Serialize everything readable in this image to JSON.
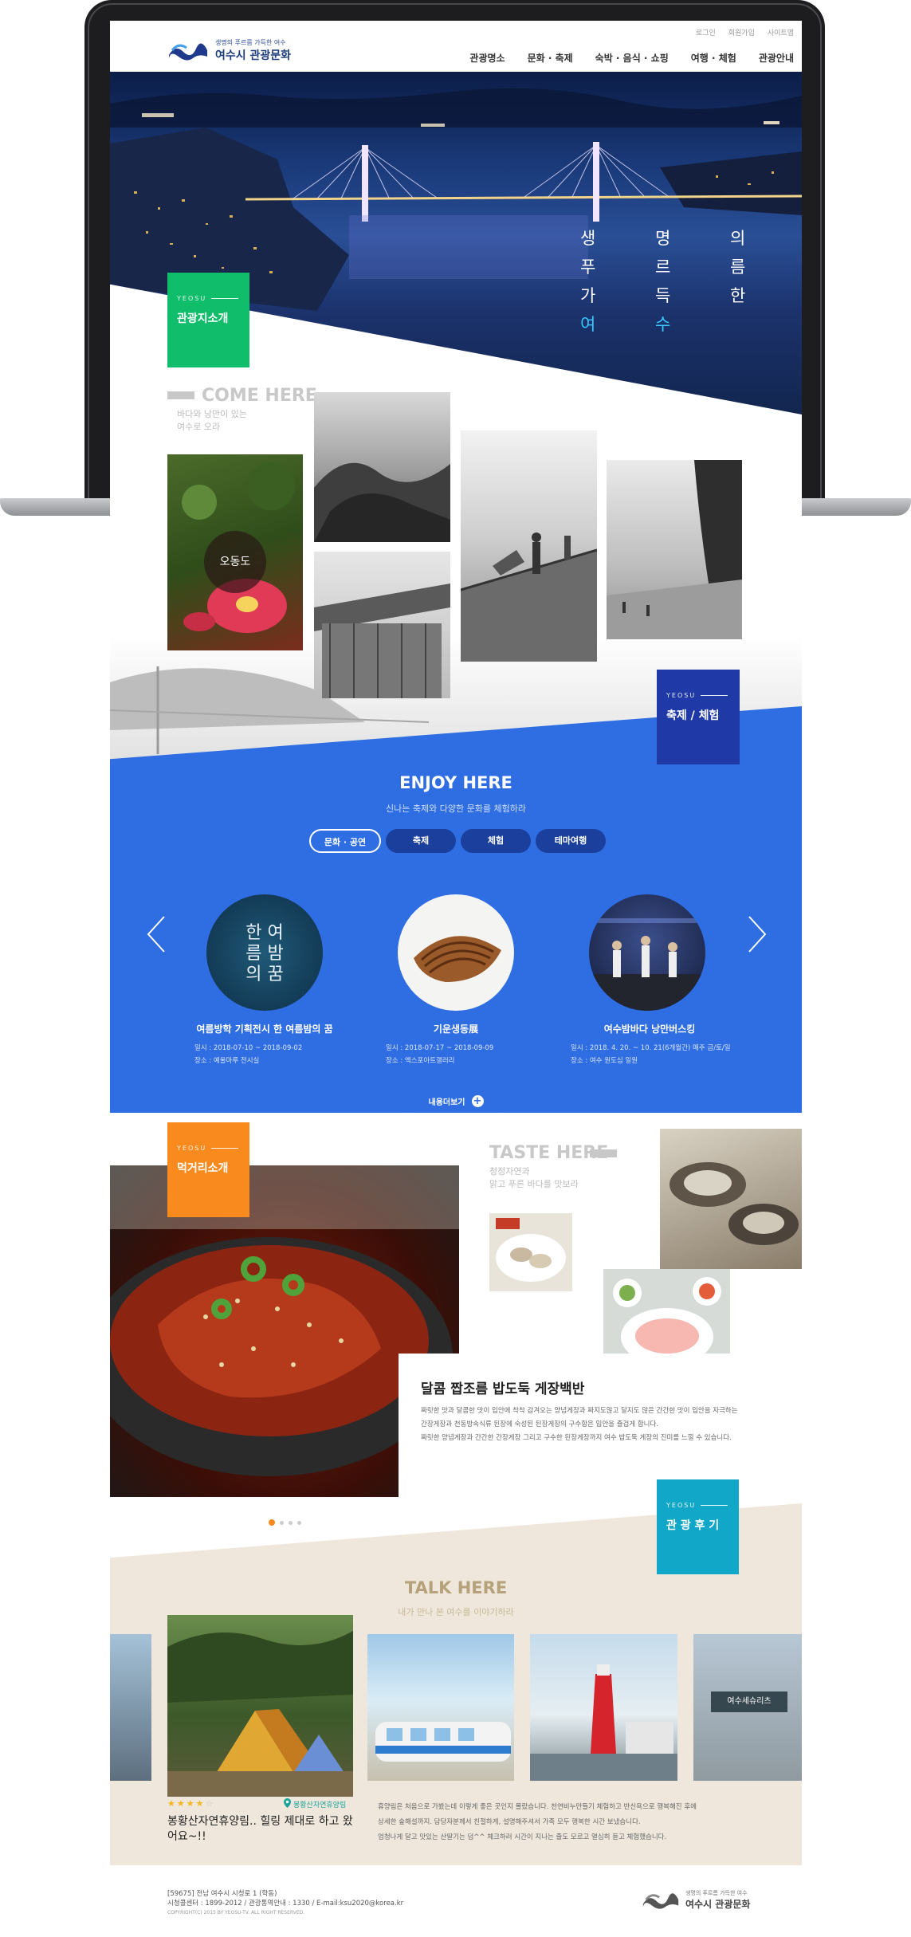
{
  "header": {
    "top_links": [
      "로그인",
      "회원가입",
      "사이트맵"
    ],
    "logo_sub": "생명의 푸르름 가득한 여수",
    "logo_main": "여수시 관광문화",
    "nav": [
      "관광명소",
      "문화 · 축제",
      "숙박 · 음식 · 쇼핑",
      "여행 · 체험",
      "관광안내"
    ]
  },
  "hero": {
    "line1": "생 명 의",
    "line2": "푸 르 름",
    "line3a": "가 득 한",
    "line3b": "여 수"
  },
  "tour": {
    "tag_en": "YEOSU",
    "tag_ko": "관광지소개",
    "title": "COME HERE",
    "sub1": "바다와 낭만이 있는",
    "sub2": "여수로 오라",
    "spot_label": "오동도"
  },
  "festival": {
    "tag_en": "YEOSU",
    "tag_ko": "축제 / 체험",
    "title": "ENJOY HERE",
    "sub": "신나는 축제와 다양한 문화를 체험하라",
    "tabs": [
      "문화 · 공연",
      "축제",
      "체험",
      "테마여행"
    ],
    "events": [
      {
        "title": "여름방학 기획전시 한 여름밤의 꿈",
        "date": "일시 : 2018-07-10 ~ 2018-09-02",
        "place": "장소 : 예울마루 전시실",
        "poster_text": "한 여름 밤의 꿈"
      },
      {
        "title": "기운생동展",
        "date": "일시 : 2018-07-17 ~ 2018-09-09",
        "place": "장소 : 엑스포아트갤러리"
      },
      {
        "title": "여수밤바다 낭만버스킹",
        "date": "일시 : 2018. 4. 20. ~ 10. 21(6개월간) 매주 금/토/일",
        "place": "장소 : 여수 원도심 일원"
      }
    ],
    "more": "내용더보기"
  },
  "food": {
    "tag_en": "YEOSU",
    "tag_ko": "먹거리소개",
    "title": "TASTE HERE",
    "sub1": "청정자연과",
    "sub2": "맑고 푸른 바다를 맛보라",
    "dish_title": "달콤 짭조름 밥도둑 게장백반",
    "dish_desc": [
      "짜릿한 맛과 달콤한 맛이 입안에 착착 감겨오는 양념게장과 짜지도않고 달지도 않은 간간한 맛이 입안을 자극하는",
      "간장게장과 천동방속식류 된장에 숙성된 된장게장의 구수함은 입안을 즐겁게 합니다.",
      "짜릿한 양념게장과 간간한 간장게장 그리고 구수한 된장게장까지 여수 밥도둑 게장의 진미를 느낄 수 있습니다."
    ]
  },
  "review": {
    "tag_en": "YEOSU",
    "tag_ko": "관 광 후 기",
    "title": "TALK HERE",
    "sub": "내가 만나 본 여수를 이야기하라",
    "location": "봉황산자연휴양림",
    "rating": 4,
    "headline": "봉황산자연휴양림.. 힐링 제대로 하고 왔어요~!!",
    "body": [
      "휴양림은 처음으로 가봤는데 이렇게 좋은 곳인지 몰랐습니다. 천연비누만들기 체험하고 반신욕으로 행복해진 후에",
      "상세한 숲해설까지. 담당자분께서 친절하게, 설명해주셔서 가족 모두 행복한 시간 보냈습니다.",
      "엄청나게 달고 맛있는 산딸기는 덤^^ 체크하러 시간이 지나는 줄도 모르고 열심히 듣고 체험했습니다."
    ],
    "thumb_sign": "여수세슈리츠"
  },
  "footer": {
    "address": "[59675] 전남 여수시 시청로 1 (학동)",
    "contact": "시청콜센터 : 1899-2012 / 관광통역안내 : 1330 / E-mail:ksu2020@korea.kr",
    "copyright": "COPYRIGHT(C) 2015 BY YEOSU-TV. ALL RIGHT RESERVED.",
    "logo_sub": "생명의 푸르름 가득한 여수",
    "logo_main": "여수시 관광문화"
  },
  "colors": {
    "green": "#0fbd6a",
    "blue": "#2f6de2",
    "navy": "#1f3aa6",
    "orange": "#f98a1e",
    "teal": "#11a7c9",
    "beige": "#efe7db"
  }
}
